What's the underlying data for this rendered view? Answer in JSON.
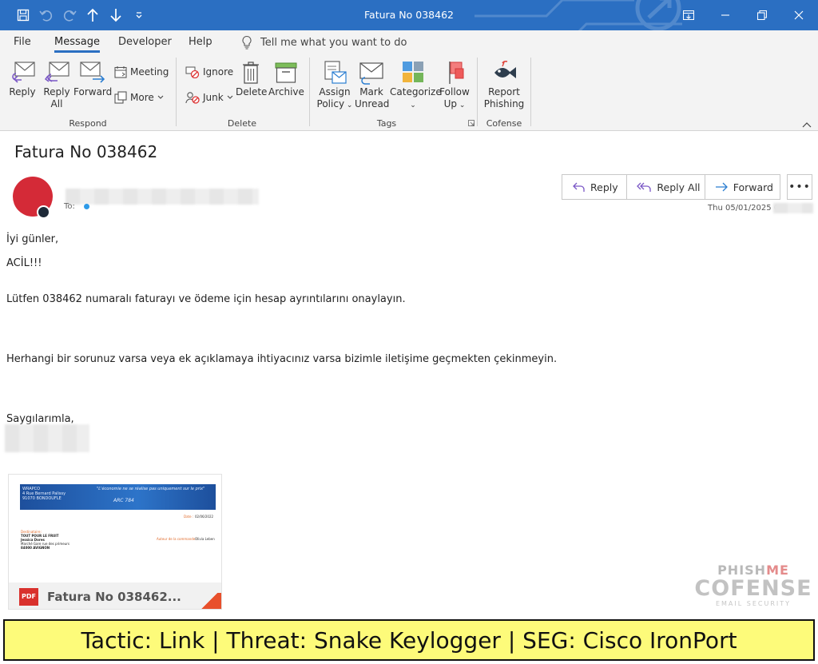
{
  "window": {
    "title": "Fatura No 038462",
    "quick_access_icons": [
      "save-icon",
      "undo-icon",
      "redo-icon",
      "up-arrow-icon",
      "down-arrow-icon",
      "customize-icon"
    ],
    "controls": [
      "ribbon-display-icon",
      "minimize-icon",
      "restore-icon",
      "close-icon"
    ],
    "accent_color": "#2b6fc2"
  },
  "menu": {
    "tabs": [
      {
        "label": "File"
      },
      {
        "label": "Message",
        "active": true
      },
      {
        "label": "Developer"
      },
      {
        "label": "Help"
      }
    ],
    "tell_me": "Tell me what you want to do"
  },
  "ribbon": {
    "respond": {
      "label": "Respond",
      "reply": [
        "Reply"
      ],
      "reply_all": [
        "Reply",
        "All"
      ],
      "forward": [
        "Forward"
      ],
      "meeting": "Meeting",
      "more": "More"
    },
    "delete": {
      "label": "Delete",
      "ignore": "Ignore",
      "junk": "Junk",
      "delete": "Delete",
      "archive": "Archive"
    },
    "tags": {
      "label": "Tags",
      "assign_policy": [
        "Assign",
        "Policy"
      ],
      "mark_unread": [
        "Mark",
        "Unread"
      ],
      "categorize": [
        "Categorize"
      ],
      "follow_up": [
        "Follow",
        "Up"
      ]
    },
    "cofense": {
      "label": "Cofense",
      "report_phishing": [
        "Report",
        "Phishing"
      ]
    }
  },
  "message": {
    "subject": "Fatura No 038462",
    "to_label": "To:",
    "date": "Thu 05/01/2025 0",
    "actions": {
      "reply": "Reply",
      "reply_all": "Reply All",
      "forward": "Forward",
      "more": "•••"
    },
    "avatar_color": "#d42a37",
    "body": {
      "greeting": "İyi günler,",
      "urgent": "ACİL!!!",
      "line1": "Lütfen 038462 numaralı faturayı ve ödeme için hesap ayrıntılarını onaylayın.",
      "line2": "Herhangi bir sorunuz varsa veya ek açıklamaya ihtiyacınız varsa bizimle iletişime geçmekten çekinmeyin.",
      "signoff": "Saygılarımla,"
    },
    "attachment": {
      "name": "Fatura No 038462...",
      "type_badge": "PDF",
      "preview": {
        "company_lines": [
          "WRAPCO",
          "4 Rue Bernard Palissy",
          "91070 BONDOUFLE"
        ],
        "tagline": "\"L'économie ne se réalise pas uniquement sur le prix\"",
        "ref": "ARC 784",
        "date_label": "Date :",
        "date_value": "02/06/2022",
        "recipient_lines": [
          "Destinataire:",
          "TOUT POUR LE FRUIT",
          "Jessica Dores",
          "Marché Gare rue des primeurs",
          "84000 AVIGNON"
        ],
        "contact_label": "Auteur de la commande :",
        "contact_value": "Olivia Leben"
      }
    }
  },
  "watermark": {
    "brand_top_a": "PHISH",
    "brand_top_b": "ME",
    "brand": "COFENSE",
    "tagline": "EMAIL SECURITY"
  },
  "banner": {
    "text": "Tactic: Link | Threat: Snake Keylogger | SEG: Cisco IronPort",
    "color": "#fdfb7a"
  }
}
